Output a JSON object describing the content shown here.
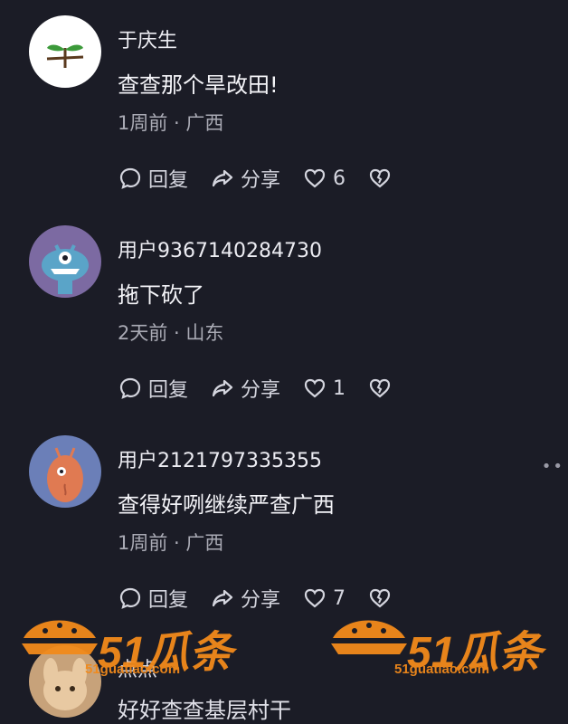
{
  "comments": [
    {
      "user": "于庆生",
      "text": "查查那个旱改田!",
      "time": "1周前",
      "region": "广西",
      "reply": "回复",
      "share": "分享",
      "likes": "6"
    },
    {
      "user": "用户9367140284730",
      "text": "拖下砍了",
      "time": "2天前",
      "region": "山东",
      "reply": "回复",
      "share": "分享",
      "likes": "1"
    },
    {
      "user": "用户2121797335355",
      "text": "查得好咧继续严查广西",
      "time": "1周前",
      "region": "广西",
      "reply": "回复",
      "share": "分享",
      "likes": "7"
    }
  ],
  "partial": {
    "user": "点点",
    "text": "好好查查基层村干"
  },
  "watermark": {
    "brand": "51瓜条",
    "url": "51guatiao.com"
  },
  "more_label": "••"
}
